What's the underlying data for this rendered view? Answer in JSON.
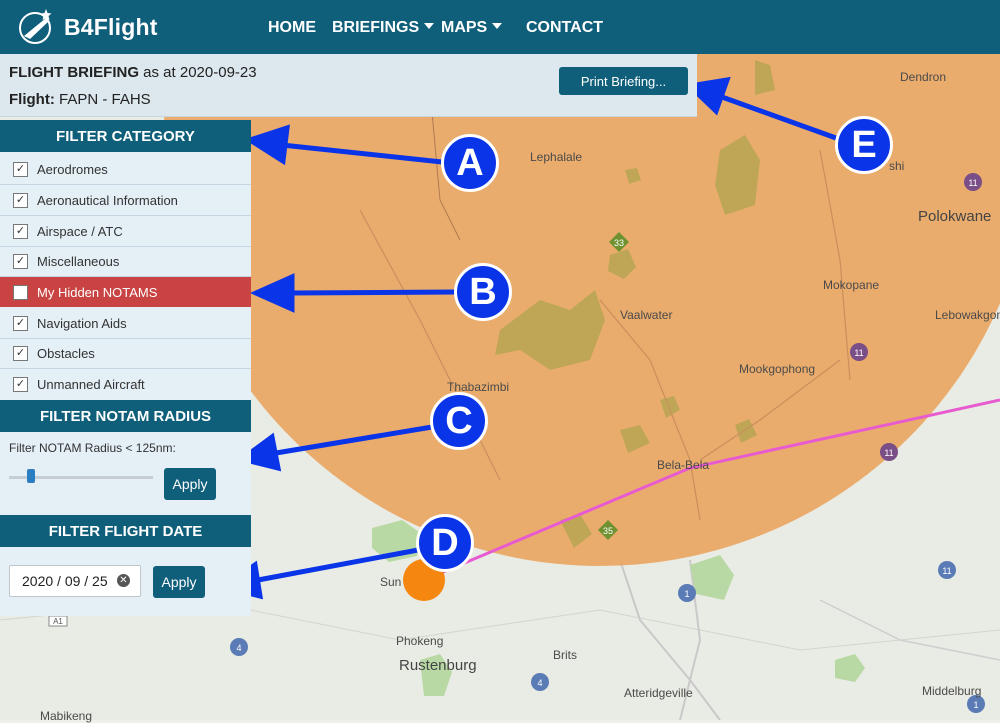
{
  "brand": {
    "name": "B4Flight"
  },
  "nav": {
    "home": "HOME",
    "briefings": "BRIEFINGS",
    "maps": "MAPS",
    "contact": "CONTACT"
  },
  "briefing": {
    "title": "FLIGHT BRIEFING",
    "as_at_label": "as at 2020-09-23",
    "flight_label": "Flight:",
    "flight_value": "FAPN - FAHS",
    "print_button": "Print Briefing..."
  },
  "filter_category": {
    "header": "FILTER CATEGORY",
    "items": [
      {
        "label": "Aerodromes",
        "checked": true
      },
      {
        "label": "Aeronautical Information",
        "checked": true
      },
      {
        "label": "Airspace / ATC",
        "checked": true
      },
      {
        "label": "Miscellaneous",
        "checked": true
      },
      {
        "label": "My Hidden NOTAMS",
        "checked": false
      },
      {
        "label": "Navigation Aids",
        "checked": true
      },
      {
        "label": "Obstacles",
        "checked": true
      },
      {
        "label": "Unmanned Aircraft",
        "checked": true
      }
    ]
  },
  "filter_radius": {
    "header": "FILTER NOTAM RADIUS",
    "label": "Filter NOTAM Radius < 125nm:",
    "apply": "Apply"
  },
  "filter_date": {
    "header": "FILTER FLIGHT DATE",
    "value": "2020 / 09 / 25",
    "apply": "Apply"
  },
  "map": {
    "towns": [
      "Dendron",
      "Lephalale",
      "Polokwane",
      "Mokopane",
      "Lebowakgomo",
      "Vaalwater",
      "Mookgophong",
      "Thabazimbi",
      "Bela-Bela",
      "Phokeng",
      "Rustenburg",
      "Brits",
      "Atteridgeville",
      "Middelburg",
      "Mabikeng",
      "Sun",
      "shi"
    ],
    "road_labels": [
      "33",
      "11",
      "11",
      "11",
      "35",
      "11",
      "1",
      "4",
      "4",
      "1",
      "A1",
      "A1"
    ]
  },
  "annotations": [
    "A",
    "B",
    "C",
    "D",
    "E"
  ],
  "colors": {
    "primary": "#0f5f7b",
    "hidden_row": "#c84342",
    "radius_fill": "#eaa55f",
    "annotation": "#0a34e8",
    "route": "#e85ad0"
  }
}
